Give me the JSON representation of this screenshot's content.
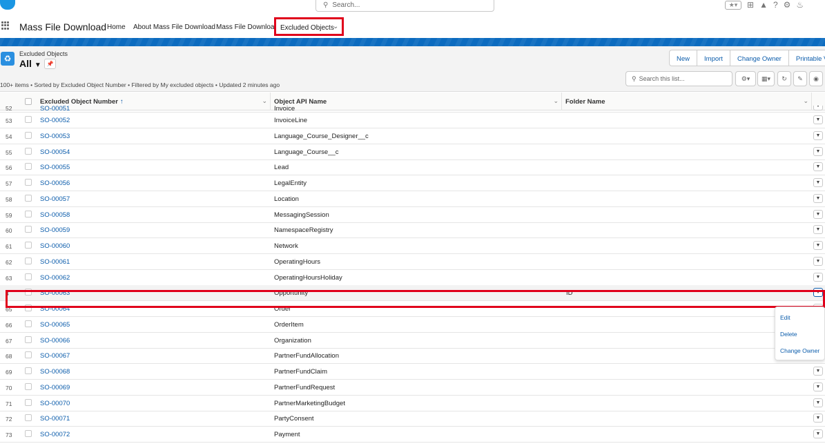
{
  "header": {
    "search_placeholder": "Search...",
    "icons": [
      "star-icon",
      "chevron-down-icon",
      "plus-icon",
      "trailhead-icon",
      "help-icon",
      "gear-icon",
      "bell-icon"
    ]
  },
  "appnav": {
    "app_name": "Mass File Download",
    "items": [
      "Home",
      "About Mass File Download",
      "Mass File Download"
    ],
    "active_tab": "Excluded Objects",
    "highlight_color": "#e0001b",
    "brand_band_color": "#0c6bbf"
  },
  "listview": {
    "object_label": "Excluded Objects",
    "view_name": "All",
    "actions": [
      "New",
      "Import",
      "Change Owner",
      "Printable Vie"
    ],
    "meta": "100+ items • Sorted by Excluded Object Number • Filtered by My excluded objects • Updated 2 minutes ago",
    "search_placeholder": "Search this list..."
  },
  "table": {
    "columns": [
      "Excluded Object Number",
      "Object API Name",
      "Folder Name"
    ],
    "sort_indicator": "↑",
    "partial_row": {
      "num": "52",
      "number": "SO-00051",
      "api": "Invoice"
    },
    "rows": [
      {
        "num": "53",
        "number": "SO-00052",
        "api": "InvoiceLine",
        "folder": ""
      },
      {
        "num": "54",
        "number": "SO-00053",
        "api": "Language_Course_Designer__c",
        "folder": ""
      },
      {
        "num": "55",
        "number": "SO-00054",
        "api": "Language_Course__c",
        "folder": ""
      },
      {
        "num": "56",
        "number": "SO-00055",
        "api": "Lead",
        "folder": ""
      },
      {
        "num": "57",
        "number": "SO-00056",
        "api": "LegalEntity",
        "folder": ""
      },
      {
        "num": "58",
        "number": "SO-00057",
        "api": "Location",
        "folder": ""
      },
      {
        "num": "59",
        "number": "SO-00058",
        "api": "MessagingSession",
        "folder": ""
      },
      {
        "num": "60",
        "number": "SO-00059",
        "api": "NamespaceRegistry",
        "folder": ""
      },
      {
        "num": "61",
        "number": "SO-00060",
        "api": "Network",
        "folder": ""
      },
      {
        "num": "62",
        "number": "SO-00061",
        "api": "OperatingHours",
        "folder": ""
      },
      {
        "num": "63",
        "number": "SO-00062",
        "api": "OperatingHoursHoliday",
        "folder": ""
      },
      {
        "num": "4",
        "number": "SO-00063",
        "api": "Opportunity",
        "folder": "ID"
      },
      {
        "num": "65",
        "number": "SO-00064",
        "api": "Order",
        "folder": ""
      },
      {
        "num": "66",
        "number": "SO-00065",
        "api": "OrderItem",
        "folder": ""
      },
      {
        "num": "67",
        "number": "SO-00066",
        "api": "Organization",
        "folder": ""
      },
      {
        "num": "68",
        "number": "SO-00067",
        "api": "PartnerFundAllocation",
        "folder": ""
      },
      {
        "num": "69",
        "number": "SO-00068",
        "api": "PartnerFundClaim",
        "folder": ""
      },
      {
        "num": "70",
        "number": "SO-00069",
        "api": "PartnerFundRequest",
        "folder": ""
      },
      {
        "num": "71",
        "number": "SO-00070",
        "api": "PartnerMarketingBudget",
        "folder": ""
      },
      {
        "num": "72",
        "number": "SO-00071",
        "api": "PartyConsent",
        "folder": ""
      },
      {
        "num": "73",
        "number": "SO-00072",
        "api": "Payment",
        "folder": ""
      }
    ],
    "highlighted_row": "SO-00063"
  },
  "row_menu": {
    "items": [
      "Edit",
      "Delete",
      "Change Owner"
    ]
  }
}
